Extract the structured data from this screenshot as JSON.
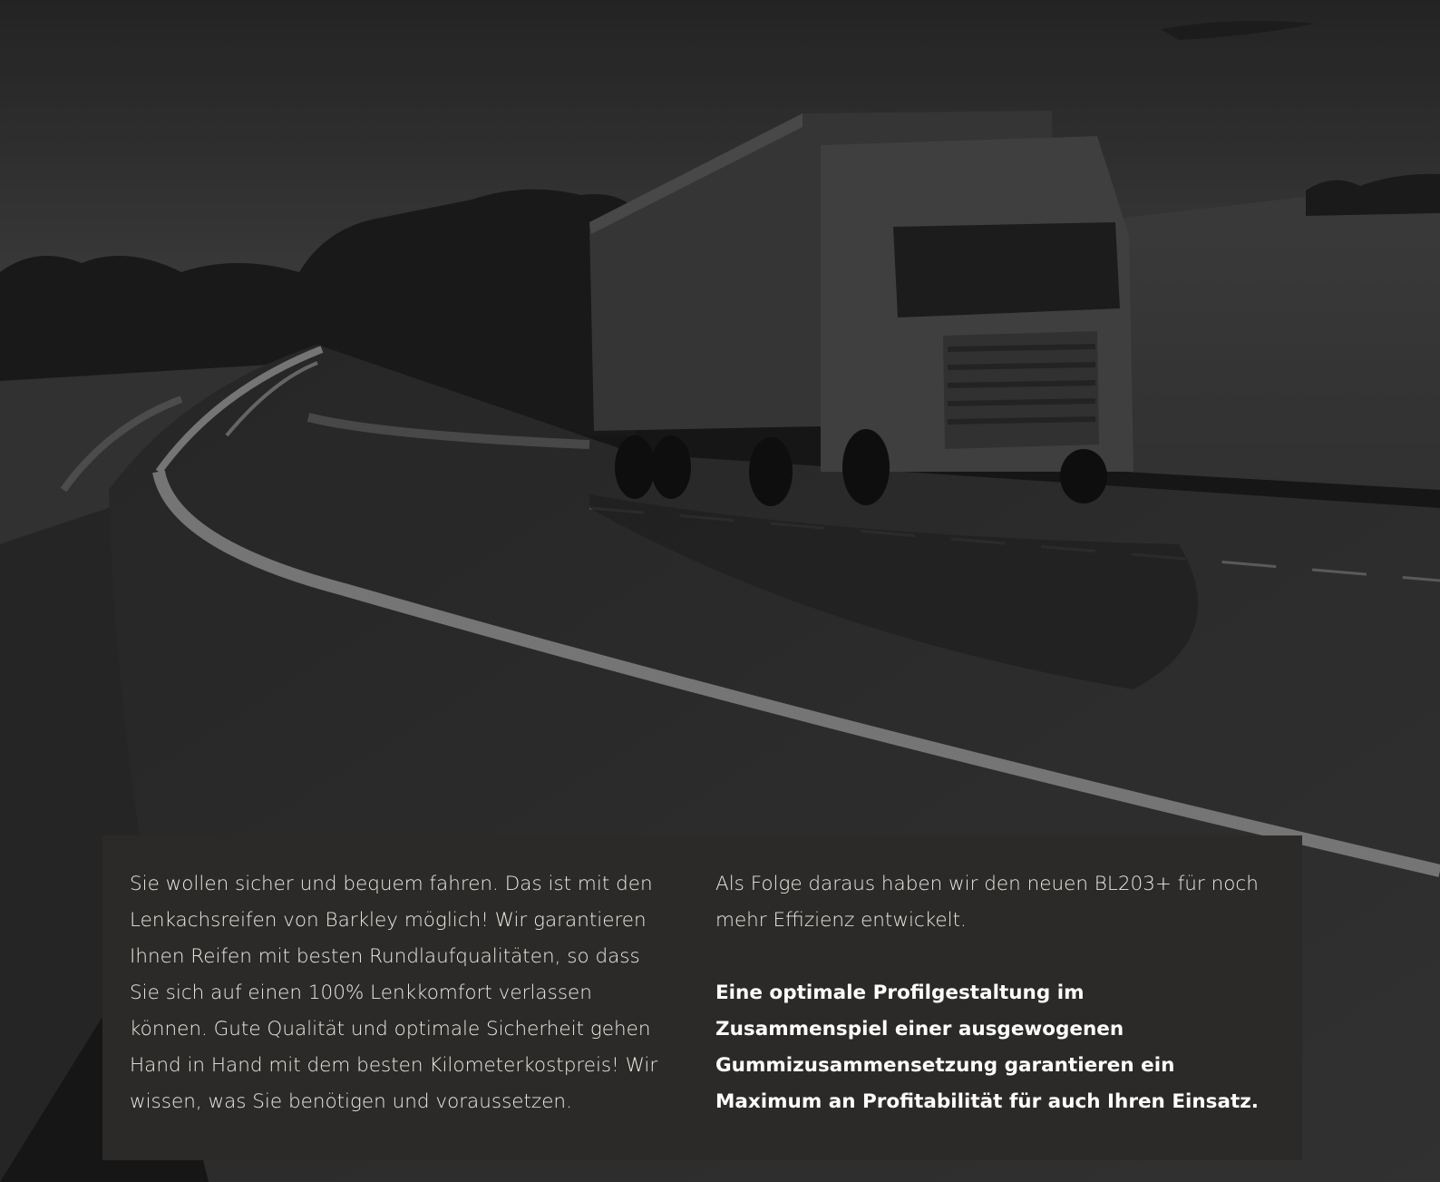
{
  "hero": {
    "image_alt": "Lkw auf einer kurvigen Landstraße in Graustufen",
    "image_icon": "truck-on-road-photo"
  },
  "panel": {
    "left_text": "Sie wollen sicher und bequem fahren. Das ist mit den Lenkachsreifen von Barkley möglich! Wir garantieren Ihnen Reifen mit besten Rundlaufqualitäten, so dass Sie sich auf einen 100% Lenkkomfort verlassen können. Gute Qualität und optimale Sicherheit gehen Hand in Hand mit dem besten Kilometerkostpreis! Wir wissen, was Sie benötigen und voraussetzen.",
    "right_text": "Als Folge daraus haben wir den neuen BL203+ für noch mehr Effizienz entwickelt.",
    "right_bold": "Eine optimale Profilgestaltung im Zusammenspiel einer ausgewogenen Gummizusammensetzung garantieren ein Maximum an Profitabilität für auch Ihren Einsatz."
  },
  "colors": {
    "panel_bg": "#2b2a28",
    "text": "#ece9e4"
  }
}
